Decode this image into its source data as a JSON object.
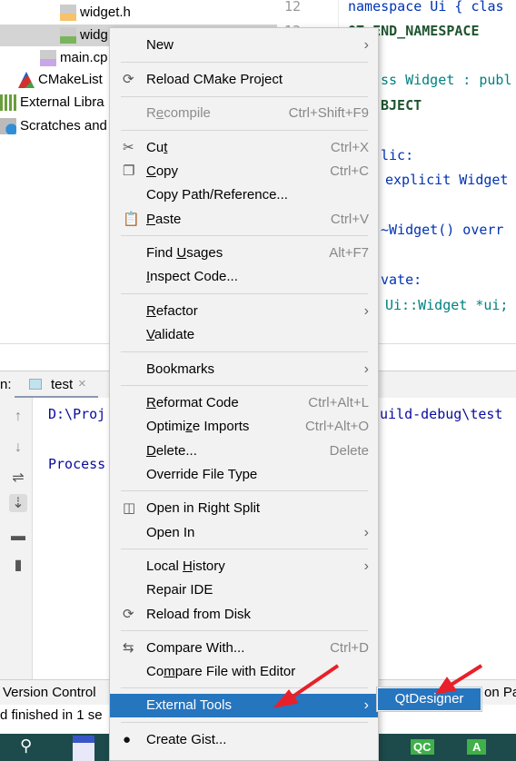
{
  "project_tree": {
    "items": [
      {
        "label": "widget.h",
        "icon": "header-file-icon"
      },
      {
        "label": "widg",
        "icon": "qt-ui-file-icon",
        "selected": true
      },
      {
        "label": "main.cp",
        "icon": "cpp-file-icon"
      },
      {
        "label": "CMakeList",
        "icon": "cmake-icon"
      },
      {
        "label": "External Libra",
        "icon": "library-icon"
      },
      {
        "label": "Scratches and",
        "icon": "scratches-icon"
      }
    ]
  },
  "editor": {
    "line_numbers": [
      "12",
      "13"
    ],
    "lines": [
      {
        "text": "namespace Ui { clas"
      },
      {
        "text": "QT_END_NAMESPACE"
      },
      {
        "text": "ss Widget : publ"
      },
      {
        "text": "BJECT"
      },
      {
        "text": "lic:"
      },
      {
        "text": "explicit Widget"
      },
      {
        "text": "~Widget() overr"
      },
      {
        "text": "vate:"
      },
      {
        "text": "Ui::Widget *ui;"
      }
    ]
  },
  "run_panel": {
    "label": "n:",
    "tab": "test",
    "console": [
      "D:\\Proj",
      "uild-debug\\test",
      "Process"
    ]
  },
  "status": {
    "tab_version_control": "Version Control",
    "message": "d finished in 1 se",
    "right_fragment": "on Pa"
  },
  "context_menu": {
    "items": [
      {
        "label": "New",
        "submenu": true
      },
      {
        "label": "Reload CMake Project",
        "icon": "reload-icon"
      },
      {
        "label": "Recompile",
        "shortcut": "Ctrl+Shift+F9",
        "disabled": true
      },
      {
        "label": "Cut",
        "shortcut": "Ctrl+X",
        "icon": "scissors-icon"
      },
      {
        "label": "Copy",
        "shortcut": "Ctrl+C",
        "icon": "copy-icon"
      },
      {
        "label": "Copy Path/Reference..."
      },
      {
        "label": "Paste",
        "shortcut": "Ctrl+V",
        "icon": "clipboard-icon"
      },
      {
        "label": "Find Usages",
        "shortcut": "Alt+F7"
      },
      {
        "label": "Inspect Code..."
      },
      {
        "label": "Refactor",
        "submenu": true
      },
      {
        "label": "Validate"
      },
      {
        "label": "Bookmarks",
        "submenu": true
      },
      {
        "label": "Reformat Code",
        "shortcut": "Ctrl+Alt+L"
      },
      {
        "label": "Optimize Imports",
        "shortcut": "Ctrl+Alt+O"
      },
      {
        "label": "Delete...",
        "shortcut": "Delete"
      },
      {
        "label": "Override File Type"
      },
      {
        "label": "Open in Right Split",
        "icon": "split-icon"
      },
      {
        "label": "Open In",
        "submenu": true
      },
      {
        "label": "Local History",
        "submenu": true
      },
      {
        "label": "Repair IDE"
      },
      {
        "label": "Reload from Disk",
        "icon": "reload-icon"
      },
      {
        "label": "Compare With...",
        "shortcut": "Ctrl+D",
        "icon": "compare-icon"
      },
      {
        "label": "Compare File with Editor"
      },
      {
        "label": "External Tools",
        "submenu": true,
        "highlighted": true
      },
      {
        "label": "Create Gist...",
        "icon": "github-icon"
      }
    ]
  },
  "submenu": {
    "items": [
      {
        "label": "QtDesigner",
        "highlighted": true
      }
    ]
  },
  "taskbar": {
    "apps": [
      "QC",
      "A"
    ]
  },
  "colors": {
    "highlight": "#2675bf",
    "menu_bg": "#f2f2f2",
    "annotation_arrow": "#e8202a"
  }
}
